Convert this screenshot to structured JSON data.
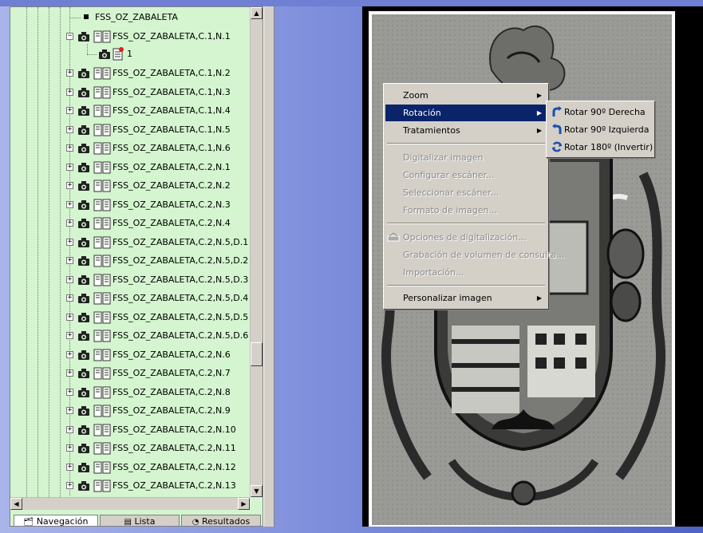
{
  "tree": {
    "root_label": "FSS_OZ_ZABALETA",
    "expanded_item": "FSS_OZ_ZABALETA,C.1,N.1",
    "child_label": "1",
    "items": [
      "FSS_OZ_ZABALETA,C.1,N.2",
      "FSS_OZ_ZABALETA,C.1,N.3",
      "FSS_OZ_ZABALETA,C.1,N.4",
      "FSS_OZ_ZABALETA,C.1,N.5",
      "FSS_OZ_ZABALETA,C.1,N.6",
      "FSS_OZ_ZABALETA,C.2,N.1",
      "FSS_OZ_ZABALETA,C.2,N.2",
      "FSS_OZ_ZABALETA,C.2,N.3",
      "FSS_OZ_ZABALETA,C.2,N.4",
      "FSS_OZ_ZABALETA,C.2,N.5,D.1",
      "FSS_OZ_ZABALETA,C.2,N.5,D.2",
      "FSS_OZ_ZABALETA,C.2,N.5,D.3",
      "FSS_OZ_ZABALETA,C.2,N.5,D.4",
      "FSS_OZ_ZABALETA,C.2,N.5,D.5",
      "FSS_OZ_ZABALETA,C.2,N.5,D.6",
      "FSS_OZ_ZABALETA,C.2,N.6",
      "FSS_OZ_ZABALETA,C.2,N.7",
      "FSS_OZ_ZABALETA,C.2,N.8",
      "FSS_OZ_ZABALETA,C.2,N.9",
      "FSS_OZ_ZABALETA,C.2,N.10",
      "FSS_OZ_ZABALETA,C.2,N.11",
      "FSS_OZ_ZABALETA,C.2,N.12",
      "FSS_OZ_ZABALETA,C.2,N.13"
    ]
  },
  "tabs": [
    "Navegación",
    "Lista",
    "Resultados"
  ],
  "context_menu": {
    "items": [
      {
        "label": "Zoom",
        "submenu": true,
        "enabled": true
      },
      {
        "label": "Rotación",
        "submenu": true,
        "enabled": true,
        "highlighted": true
      },
      {
        "label": "Tratamientos",
        "submenu": true,
        "enabled": true
      },
      {
        "label": "Digitalizar imagen",
        "enabled": false
      },
      {
        "label": "Configurar escáner...",
        "enabled": false
      },
      {
        "label": "Seleccionar escáner...",
        "enabled": false
      },
      {
        "label": "Formato de imagen...",
        "enabled": false
      },
      {
        "label": "Opciones de digitalización...",
        "enabled": false
      },
      {
        "label": "Grabación de volumen de consulta...",
        "enabled": false
      },
      {
        "label": "Importación...",
        "enabled": false
      },
      {
        "label": "Personalizar imagen",
        "submenu": true,
        "enabled": true
      }
    ]
  },
  "rotation_submenu": {
    "items": [
      {
        "label": "Rotar  90º Derecha",
        "icon": "rotate-right-icon"
      },
      {
        "label": "Rotar  90º Izquierda",
        "icon": "rotate-left-icon"
      },
      {
        "label": "Rotar 180º (Invertir)",
        "icon": "rotate-180-icon"
      }
    ]
  },
  "colors": {
    "tree_bg": "#d4f5cf",
    "menu_bg": "#d4d0c8",
    "highlight": "#0a246a",
    "rotate_icon": "#1a4fb0"
  }
}
